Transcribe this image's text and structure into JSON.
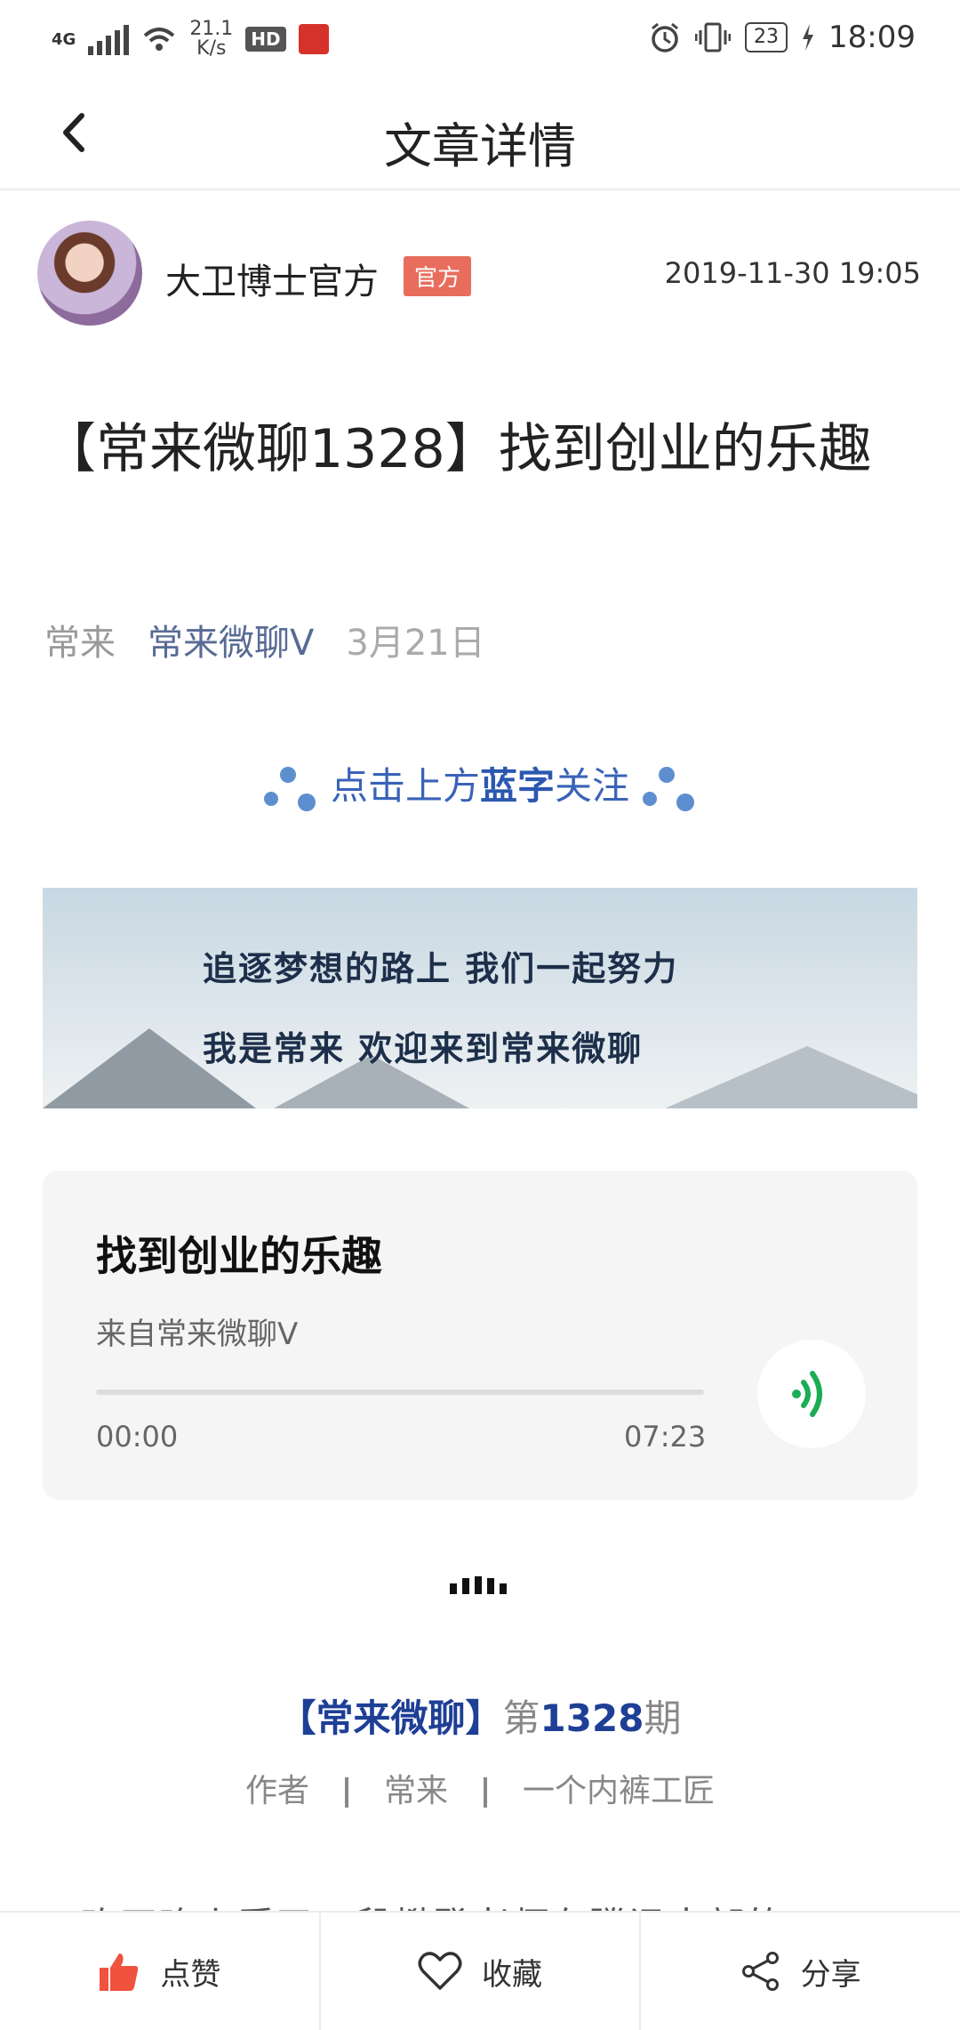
{
  "status_bar": {
    "network": "4G",
    "speed_value": "21.1",
    "speed_unit": "K/s",
    "hd": "HD",
    "battery": "23",
    "time": "18:09"
  },
  "nav": {
    "title": "文章详情"
  },
  "author": {
    "name": "大卫博士官方",
    "badge": "官方",
    "datetime": "2019-11-30 19:05"
  },
  "article": {
    "title": "【常来微聊1328】找到创业的乐趣",
    "meta_author": "常来",
    "meta_account": "常来微聊V",
    "meta_date": "3月21日",
    "follow_prefix": "点击上方",
    "follow_bold": "蓝字",
    "follow_suffix": "关注",
    "banner_line1": "追逐梦想的路上   我们一起努力",
    "banner_line2": "我是常来      欢迎来到常来微聊",
    "issue_bracket": "【常来微聊】",
    "issue_prefix": "第",
    "issue_number": "1328",
    "issue_suffix": "期",
    "byline_label": "作者",
    "byline_name": "常来",
    "byline_role": "一个内裤工匠",
    "body_cut_text": "昨天晚上看了一段樊登老师在腾讯大部的"
  },
  "audio": {
    "title": "找到创业的乐趣",
    "source": "来自常来微聊V",
    "current": "00:00",
    "duration": "07:23",
    "progress_fraction": 0
  },
  "bottom_bar": {
    "like": "点赞",
    "collect": "收藏",
    "share": "分享"
  },
  "colors": {
    "link_blue": "#576b95",
    "badge_red": "#e96d5d",
    "play_green": "#1aad54",
    "like_red": "#f0523e"
  }
}
